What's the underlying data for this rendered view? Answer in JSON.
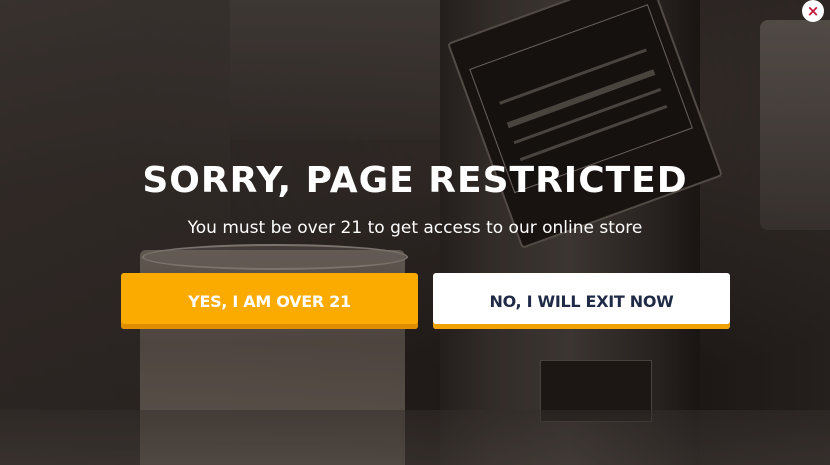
{
  "background": {
    "description_icon": "whisky-bottle-and-glass-photo"
  },
  "modal": {
    "title": "SORRY, PAGE RESTRICTED",
    "subtitle": "You must be over 21 to get access to our online store",
    "yes_button": "YES, I AM OVER 21",
    "no_button": "NO, I WILL EXIT NOW",
    "close_label": "×"
  },
  "colors": {
    "accent": "#fbab00",
    "accent_shadow": "#e08e00",
    "no_button_text": "#1f2a46",
    "close_icon": "#c21a3a"
  }
}
